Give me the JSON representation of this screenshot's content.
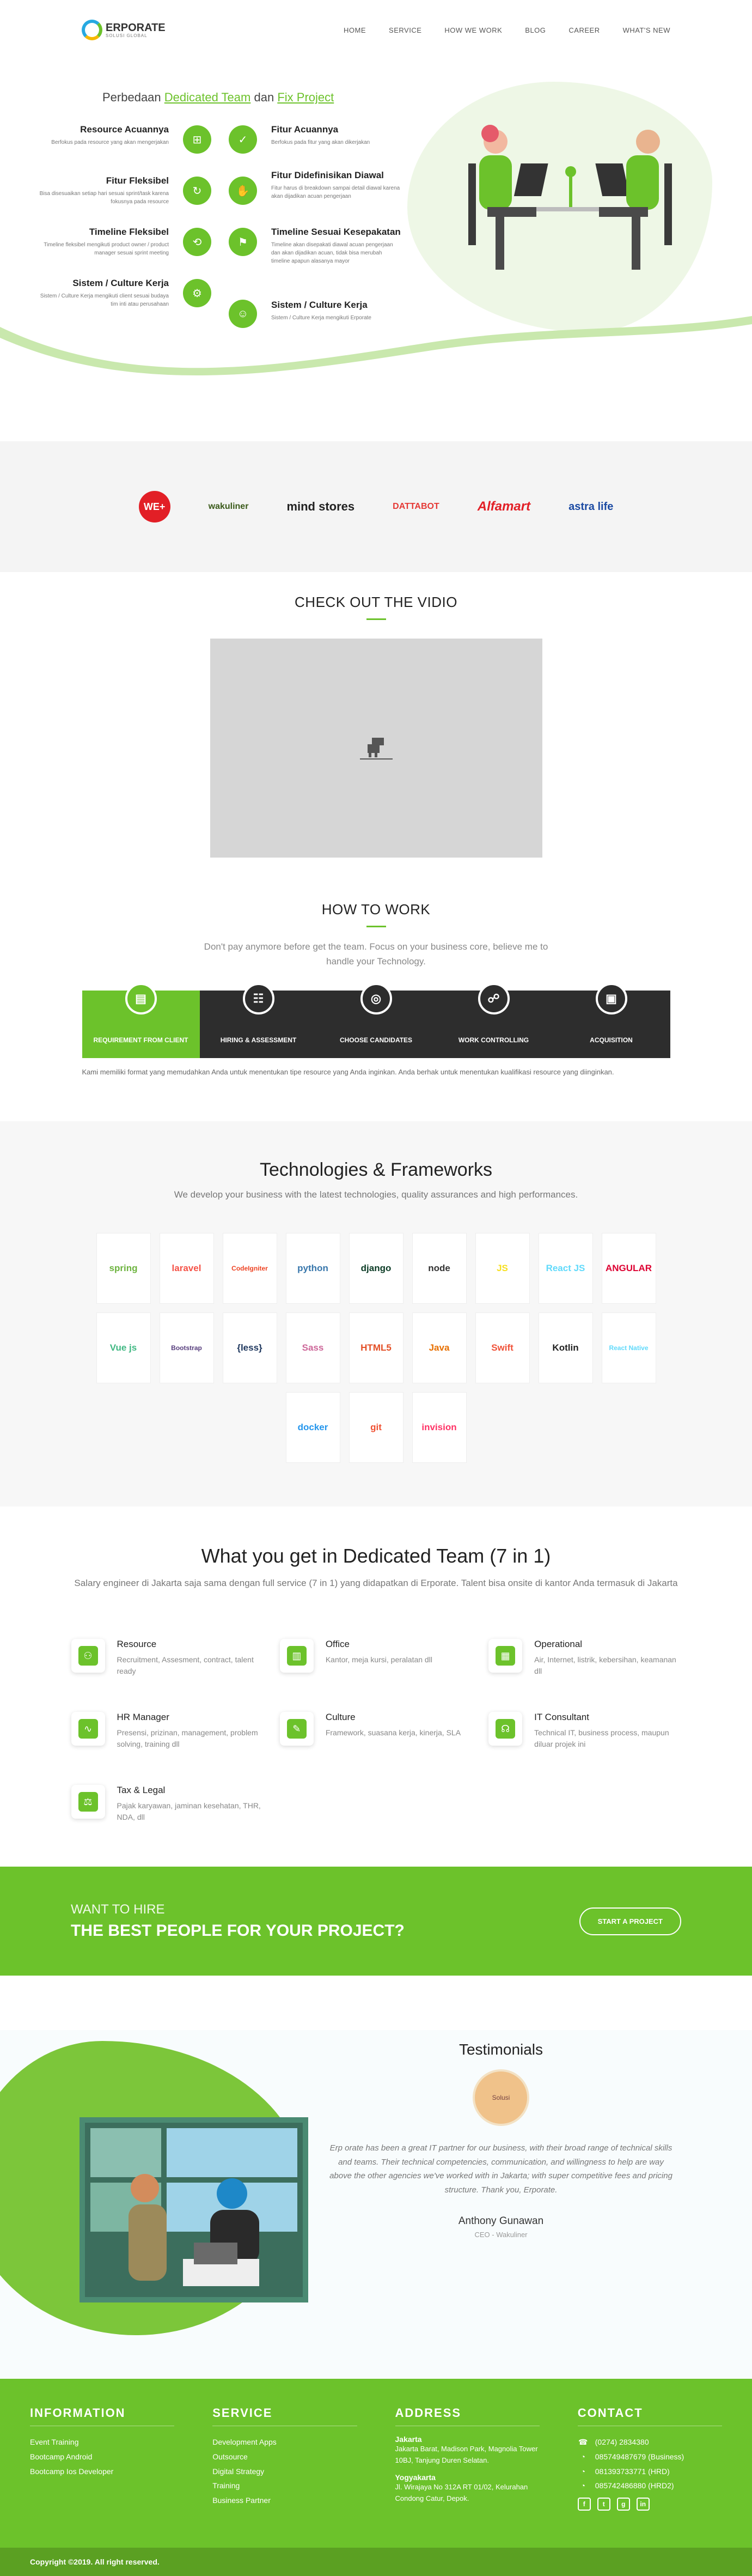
{
  "nav": {
    "logo_name": "ERPORATE",
    "logo_sub": "SOLUSI GLOBAL",
    "items": [
      "HOME",
      "SERVICE",
      "HOW WE WORK",
      "BLOG",
      "CAREER",
      "WHAT'S NEW"
    ]
  },
  "hero": {
    "title_pre": "Perbedaan",
    "title_a": "Dedicated Team",
    "title_mid": "dan",
    "title_b": "Fix Project",
    "left": [
      {
        "title": "Resource Acuannya",
        "desc": "Berfokus pada resource yang akan mengerjakan"
      },
      {
        "title": "Fitur Fleksibel",
        "desc": "Bisa disesuaikan setiap hari sesuai sprint/task karena fokusnya pada resource"
      },
      {
        "title": "Timeline Fleksibel",
        "desc": "Timeline fleksibel mengikuti product owner / product manager sesuai sprint meeting"
      },
      {
        "title": "Sistem / Culture Kerja",
        "desc": "Sistem / Culture Kerja mengikuti client sesuai budaya tim inti atau perusahaan"
      }
    ],
    "right": [
      {
        "title": "Fitur Acuannya",
        "desc": "Berfokus pada fitur yang akan dikerjakan"
      },
      {
        "title": "Fitur Didefinisikan Diawal",
        "desc": "Fitur harus di breakdown sampai detail diawal karena akan dijadikan acuan pengerjaan"
      },
      {
        "title": "Timeline Sesuai Kesepakatan",
        "desc": "Timeline akan disepakati diawal acuan pengerjaan dan akan dijadikan acuan, tidak bisa merubah timeline apapun alasanya mayor"
      },
      {
        "title": "Sistem / Culture Kerja",
        "desc": "Sistem / Culture Kerja mengikuti Erporate"
      }
    ]
  },
  "clients": [
    "WE+",
    "wakuliner",
    "mind stores",
    "DATTABOT",
    "Alfamart",
    "astra life"
  ],
  "video": {
    "title": "CHECK OUT THE VIDIO"
  },
  "how": {
    "title": "HOW TO WORK",
    "subtitle": "Don't pay anymore before get the team. Focus on your business core, believe me to handle your Technology.",
    "steps": [
      "REQUIREMENT FROM CLIENT",
      "HIRING & ASSESSMENT",
      "CHOOSE CANDIDATES",
      "WORK CONTROLLING",
      "ACQUISITION"
    ],
    "note": "Kami memiliki format yang memudahkan Anda untuk menentukan tipe resource yang Anda inginkan. Anda berhak untuk menentukan kualifikasi resource yang diinginkan."
  },
  "tech": {
    "title": "Technologies & Frameworks",
    "subtitle": "We develop your business with the latest technologies, quality assurances and high performances.",
    "items": [
      {
        "name": "spring",
        "color": "#6db33f"
      },
      {
        "name": "laravel",
        "color": "#f55247"
      },
      {
        "name": "CodeIgniter",
        "color": "#ee4323"
      },
      {
        "name": "python",
        "color": "#3776ab"
      },
      {
        "name": "django",
        "color": "#0c3c26"
      },
      {
        "name": "node",
        "color": "#333333"
      },
      {
        "name": "JS",
        "color": "#f7df1e"
      },
      {
        "name": "React JS",
        "color": "#61dafb"
      },
      {
        "name": "ANGULAR",
        "color": "#dd0031"
      },
      {
        "name": "Vue js",
        "color": "#41b883"
      },
      {
        "name": "Bootstrap",
        "color": "#563d7c"
      },
      {
        "name": "{less}",
        "color": "#1d365d"
      },
      {
        "name": "Sass",
        "color": "#cd6799"
      },
      {
        "name": "HTML5",
        "color": "#e34f26"
      },
      {
        "name": "Java",
        "color": "#e76f00"
      },
      {
        "name": "Swift",
        "color": "#f05138"
      },
      {
        "name": "Kotlin",
        "color": "#222222"
      },
      {
        "name": "React Native",
        "color": "#61dafb"
      },
      {
        "name": "docker",
        "color": "#2496ed"
      },
      {
        "name": "git",
        "color": "#f05032"
      },
      {
        "name": "invision",
        "color": "#ff3366"
      }
    ]
  },
  "dedicated": {
    "title": "What you get in Dedicated Team (7 in 1)",
    "subtitle": "Salary engineer di Jakarta saja sama dengan full service (7 in 1) yang didapatkan di Erporate. Talent bisa onsite di kantor Anda termasuk di Jakarta",
    "items": [
      {
        "title": "Resource",
        "desc": "Recruitment, Assesment, contract, talent ready"
      },
      {
        "title": "Office",
        "desc": "Kantor, meja kursi, peralatan dll"
      },
      {
        "title": "Operational",
        "desc": "Air, Internet, listrik, kebersihan, keamanan dll"
      },
      {
        "title": "HR Manager",
        "desc": "Presensi, prizinan, management, problem solving, training dll"
      },
      {
        "title": "Culture",
        "desc": "Framework, suasana kerja, kinerja, SLA"
      },
      {
        "title": "IT Consultant",
        "desc": "Technical IT, business process, maupun diluar projek ini"
      },
      {
        "title": "Tax & Legal",
        "desc": "Pajak karyawan, jaminan kesehatan, THR, NDA, dll"
      }
    ]
  },
  "hire": {
    "line1": "WANT TO HIRE",
    "line2": "THE BEST PEOPLE FOR YOUR PROJECT?",
    "button": "START A PROJECT"
  },
  "testimonials": {
    "title": "Testimonials",
    "avatar_label": "Solusi",
    "quote": "Erp orate has been a great IT partner for our business, with their broad range of technical skills and teams. Their technical competencies, communication, and willingness to help are way above the other agencies we've worked with in Jakarta; with super competitive fees and pricing structure. Thank you, Erporate.",
    "name": "Anthony Gunawan",
    "role": "CEO - Wakuliner"
  },
  "footer": {
    "info_title": "INFORMATION",
    "info_items": [
      "Event Training",
      "Bootcamp Android",
      "Bootcamp Ios Developer"
    ],
    "service_title": "SERVICE",
    "service_items": [
      "Development Apps",
      "Outsource",
      "Digital Strategy",
      "Training",
      "Business Partner"
    ],
    "address_title": "ADDRESS",
    "addr1_city": "Jakarta",
    "addr1": "Jakarta Barat, Madison Park, Magnolia Tower 10BJ, Tanjung Duren Selatan.",
    "addr2_city": "Yogyakarta",
    "addr2": "Jl. Wirajaya No 312A RT 01/02, Kelurahan Condong Catur, Depok.",
    "contact_title": "CONTACT",
    "contacts": [
      "(0274) 2834380",
      "085749487679 (Business)",
      "081393733771 (HRD)",
      "085742486880 (HRD2)"
    ],
    "copyright": "Copyright ©2019. All right reserved."
  },
  "colors": {
    "accent": "#6cc22b",
    "dark": "#2d2d2d"
  }
}
